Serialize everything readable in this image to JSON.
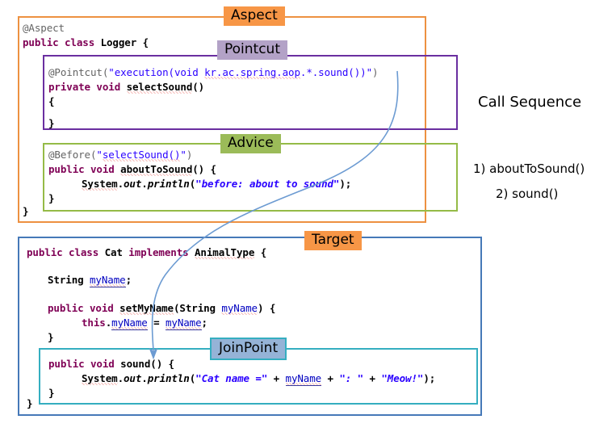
{
  "labels": {
    "aspect": "Aspect",
    "pointcut": "Pointcut",
    "advice": "Advice",
    "target": "Target",
    "joinpoint": "JoinPoint"
  },
  "colors": {
    "aspect_border": "#ED9141",
    "aspect_label_bg": "#F79646",
    "pointcut_border": "#6A2FA0",
    "pointcut_label_bg": "#B3A2C7",
    "advice_border": "#95BB47",
    "advice_label_bg": "#9BBB59",
    "target_border": "#4679B8",
    "target_label_bg": "#F79646",
    "joinpoint_border": "#35AEC0",
    "joinpoint_label_bg": "#95B3D7",
    "arrow": "#6C9BD2",
    "keyword": "#7F0055",
    "string": "#2A00FF",
    "annotation": "#646464",
    "field": "#0000C0"
  },
  "aspect_code": {
    "line1_annotation": "@Aspect",
    "line2_kw_public": "public",
    "line2_kw_class": "class",
    "line2_name": "Logger",
    "line2_brace": "{",
    "closing_brace": "}"
  },
  "pointcut_code": {
    "line1_annotation": "@Pointcut(",
    "line1_string_open": "\"execution(void ",
    "line1_string_pkg": "kr.ac.spring.aop",
    "line1_string_rest": ".*.sound())\"",
    "line1_close": ")",
    "line2_kw_private": "private",
    "line2_kw_void": "void",
    "line2_method": "selectSound",
    "line2_parens": "()",
    "line3_open_brace": "{",
    "line4_close_brace": "}"
  },
  "advice_code": {
    "line1_annotation": "@Before(",
    "line1_string_q1": "\"",
    "line1_string_method": "selectSound()",
    "line1_string_q2": "\"",
    "line1_close": ")",
    "line2_kw_public": "public",
    "line2_kw_void": "void",
    "line2_method": "aboutToSound",
    "line2_rest": "() {",
    "line3_system": "System",
    "line3_dot1": ".",
    "line3_out": "out",
    "line3_dot2": ".",
    "line3_println": "println",
    "line3_paren": "(",
    "line3_string": "\"before: about to sound\"",
    "line3_end": ");",
    "line4_close_brace": "}"
  },
  "target_code": {
    "line1_kw_public": "public",
    "line1_kw_class": "class",
    "line1_name": "Cat",
    "line1_kw_implements": "implements",
    "line1_iface": "AnimalType",
    "line1_brace": "{",
    "line2_type": "String",
    "line2_field": "myName",
    "line2_semi": ";",
    "line3_kw_public": "public",
    "line3_kw_void": "void",
    "line3_method": "setMyName",
    "line3_paren_open": "(",
    "line3_param_type": "String",
    "line3_param_name": "myName",
    "line3_paren_close": ") {",
    "line4_this": "this",
    "line4_dot": ".",
    "line4_field": "myName",
    "line4_assign": " = ",
    "line4_value": "myName",
    "line4_semi": ";",
    "line5_close_brace": "}",
    "closing_brace": "}"
  },
  "joinpoint_code": {
    "line1_kw_public": "public",
    "line1_kw_void": "void",
    "line1_method": "sound",
    "line1_rest": "() {",
    "line2_system": "System",
    "line2_dot1": ".",
    "line2_out": "out",
    "line2_dot2": ".",
    "line2_println": "println",
    "line2_paren": "(",
    "line2_str1": "\"Cat name =\"",
    "line2_plus1": " + ",
    "line2_var": "myName",
    "line2_plus2": " + ",
    "line2_str2": "\": \"",
    "line2_plus3": " + ",
    "line2_str3": "\"Meow!\"",
    "line2_end": ");",
    "line3_close_brace": "}"
  },
  "call_sequence": {
    "title": "Call Sequence",
    "items": [
      "1) aboutToSound()",
      "2) sound()"
    ]
  }
}
